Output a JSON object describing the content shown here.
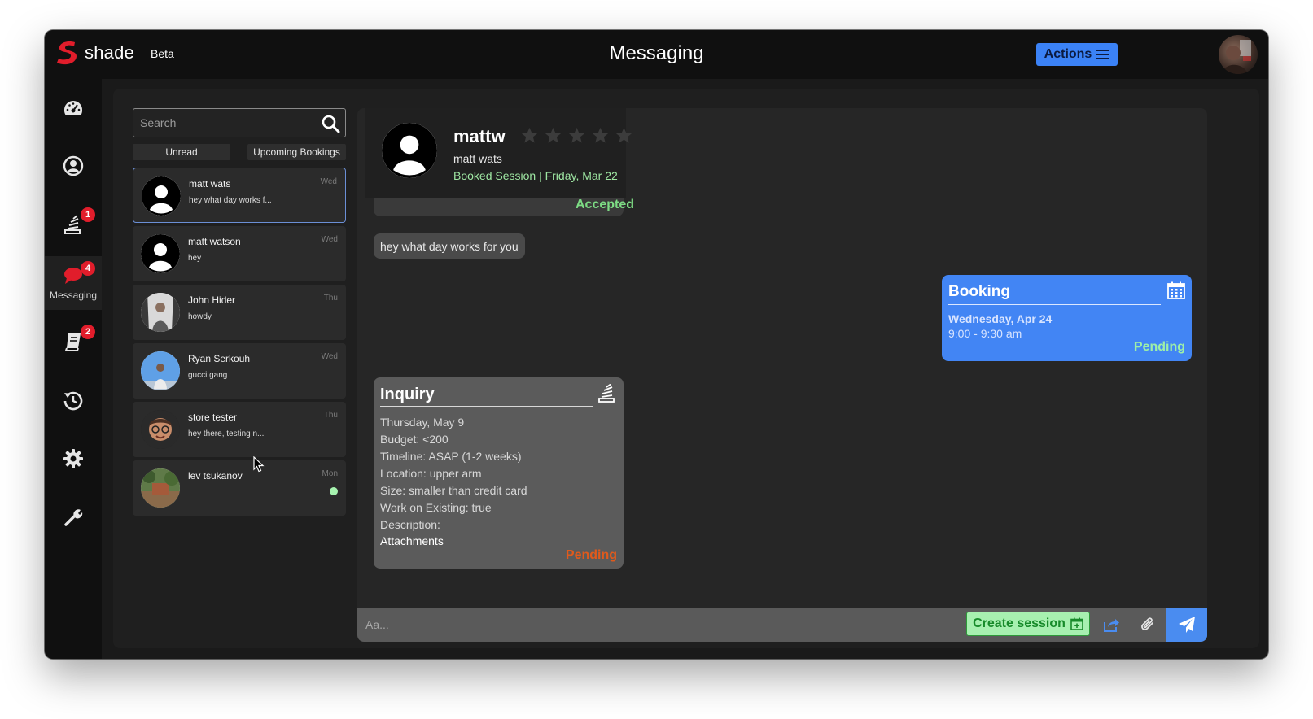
{
  "app": {
    "brand": "shade",
    "beta_label": "Beta",
    "page_title": "Messaging",
    "actions_label": "Actions",
    "brand_color": "#e11d2b",
    "accent_color": "#3b82f6"
  },
  "sidebar": {
    "items": [
      {
        "icon": "dashboard-icon",
        "label": "",
        "badge": ""
      },
      {
        "icon": "profile-icon",
        "label": "",
        "badge": ""
      },
      {
        "icon": "inquiries-icon",
        "label": "",
        "badge": "1"
      },
      {
        "icon": "chat-icon",
        "label": "Messaging",
        "badge": "4",
        "active": true
      },
      {
        "icon": "book-icon",
        "label": "",
        "badge": "2"
      },
      {
        "icon": "history-icon",
        "label": "",
        "badge": ""
      },
      {
        "icon": "gear-icon",
        "label": "",
        "badge": ""
      },
      {
        "icon": "wrench-icon",
        "label": "",
        "badge": ""
      }
    ]
  },
  "inbox": {
    "search_placeholder": "Search",
    "filters": [
      "Unread",
      "Upcoming Bookings"
    ],
    "conversations": [
      {
        "name": "matt wats",
        "preview": "hey what day works f...",
        "day": "Wed",
        "selected": true,
        "online": false
      },
      {
        "name": "matt watson",
        "preview": "hey",
        "day": "Wed",
        "selected": false,
        "online": false
      },
      {
        "name": "John Hider",
        "preview": "howdy",
        "day": "Thu",
        "selected": false,
        "online": false
      },
      {
        "name": "Ryan Serkouh",
        "preview": "gucci gang",
        "day": "Wed",
        "selected": false,
        "online": false
      },
      {
        "name": "store tester",
        "preview": "hey there, testing n...",
        "day": "Thu",
        "selected": false,
        "online": false
      },
      {
        "name": "lev tsukanov",
        "preview": "",
        "day": "Mon",
        "selected": false,
        "online": true
      }
    ]
  },
  "chat": {
    "contact_handle": "mattw",
    "contact_name": "matt wats",
    "rating": 0,
    "booked_session": "Booked Session | Friday, Mar 22",
    "session_status": "Accepted",
    "messages": [
      {
        "text": "hey what day works for you"
      }
    ],
    "booking": {
      "title": "Booking",
      "date": "Wednesday, Apr 24",
      "time": "9:00 - 9:30 am",
      "status": "Pending"
    },
    "inquiry": {
      "title": "Inquiry",
      "lines": [
        "Thursday, May 9",
        "Budget: <200",
        "Timeline: ASAP (1-2 weeks)",
        "Location: upper arm",
        "Size: smaller than credit card",
        "Work on Existing: true",
        "Description:"
      ],
      "attachments_label": "Attachments",
      "status": "Pending"
    },
    "composer": {
      "placeholder": "Aa...",
      "create_session_label": "Create session"
    }
  }
}
